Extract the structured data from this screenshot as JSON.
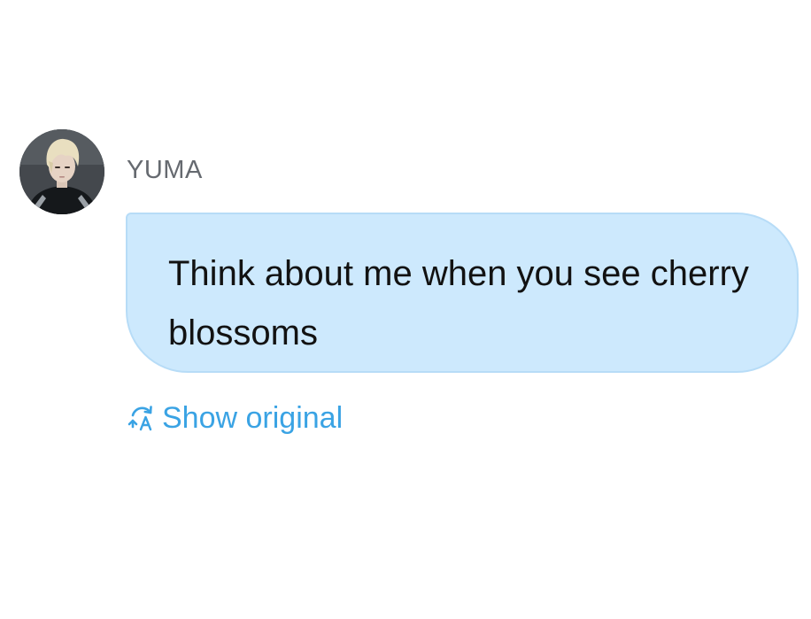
{
  "message": {
    "sender": "YUMA",
    "avatar_icon": "profile-photo",
    "text": "Think about me when you see cherry blossoms",
    "bubble_color": "#cde9fd"
  },
  "translate": {
    "label": "Show original",
    "icon": "translate-refresh-icon",
    "color": "#3aa3e4"
  }
}
